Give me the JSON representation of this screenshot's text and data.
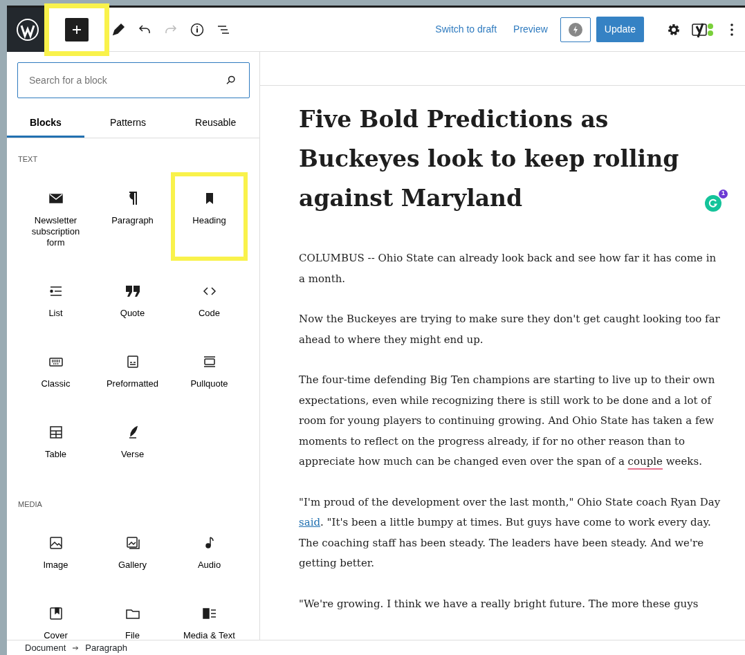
{
  "toolbar": {
    "inserter": {
      "highlighted": true
    },
    "redo": {
      "disabled": true
    },
    "actions": [
      {
        "kind": "link",
        "label": "Switch to draft"
      },
      {
        "kind": "link",
        "label": "Preview"
      },
      {
        "kind": "primary",
        "label": "Update"
      }
    ]
  },
  "inserter_panel": {
    "search": {
      "placeholder": "Search for a block"
    },
    "tabs": [
      {
        "label": "Blocks",
        "selected": true
      },
      {
        "label": "Patterns",
        "selected": false
      },
      {
        "label": "Reusable",
        "selected": false
      }
    ],
    "sections": [
      {
        "title": "TEXT",
        "items": [
          {
            "label": "Newsletter subscription form",
            "highlighted": false
          },
          {
            "label": "Paragraph",
            "highlighted": false
          },
          {
            "label": "Heading",
            "highlighted": true
          },
          {
            "label": "List",
            "highlighted": false
          },
          {
            "label": "Quote",
            "highlighted": false
          },
          {
            "label": "Code",
            "highlighted": false
          },
          {
            "label": "Classic",
            "highlighted": false
          },
          {
            "label": "Preformatted",
            "highlighted": false
          },
          {
            "label": "Pullquote",
            "highlighted": false
          },
          {
            "label": "Table",
            "highlighted": false
          },
          {
            "label": "Verse",
            "highlighted": false
          }
        ]
      },
      {
        "title": "MEDIA",
        "items": [
          {
            "label": "Image",
            "highlighted": false
          },
          {
            "label": "Gallery",
            "highlighted": false
          },
          {
            "label": "Audio",
            "highlighted": false
          },
          {
            "label": "Cover",
            "highlighted": false
          },
          {
            "label": "File",
            "highlighted": false
          },
          {
            "label": "Media & Text",
            "highlighted": false
          }
        ]
      }
    ]
  },
  "post": {
    "title": "Five Bold Predictions as Buckeyes look to keep rolling against Maryland",
    "grammarly_badge": "1",
    "paragraphs": [
      [
        {
          "kind": "text",
          "text": "COLUMBUS -- Ohio State can already look back and see how far it has come in a month."
        }
      ],
      [
        {
          "kind": "text",
          "text": "Now the Buckeyes are trying to make sure they don't get caught looking too far ahead to where they might end up."
        }
      ],
      [
        {
          "kind": "text",
          "text": "The four-time defending Big Ten champions are starting to live up to their own expectations, even while recognizing there is still work to be done and a lot of room for young players to continuing growing. And Ohio State has taken a few moments to reflect on the progress already, if for no other reason than to appreciate how much can be changed even over the span of a "
        },
        {
          "kind": "flagged",
          "text": "couple"
        },
        {
          "kind": "text",
          "text": " weeks."
        }
      ],
      [
        {
          "kind": "text",
          "text": "\"I'm proud of the development over the last month,\" Ohio State coach Ryan Day "
        },
        {
          "kind": "link",
          "text": "said"
        },
        {
          "kind": "text",
          "text": ". \"It's been a little bumpy at times. But guys have come to work every day. The coaching staff has been steady. The leaders have been steady. And we're getting better."
        }
      ],
      [
        {
          "kind": "text",
          "text": "\"We're growing. I think we have a really bright future. The more these guys"
        }
      ]
    ]
  },
  "breadcrumb": [
    "Document",
    "Paragraph"
  ]
}
